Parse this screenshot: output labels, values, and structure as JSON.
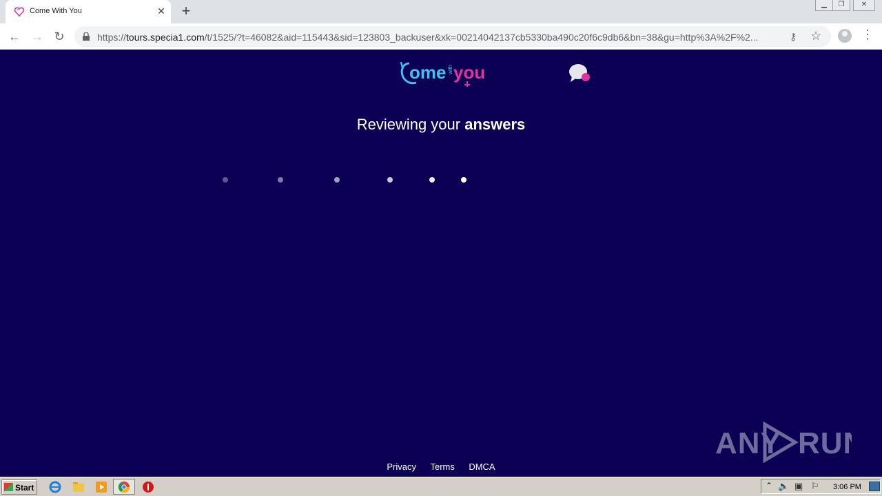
{
  "browser": {
    "tab_title": "Come With You",
    "url_host": "tours.specia1.com",
    "url_scheme": "https://",
    "url_path": "/t/1525/?t=46082&aid=115443&sid=123803_backuser&xk=00214042137cb5330ba490c20f6c9db6&bn=38&gu=http%3A%2F%2..."
  },
  "page": {
    "logo_text_left": "ome",
    "logo_text_small": "with",
    "logo_text_right": "you",
    "heading_normal": "Reviewing your ",
    "heading_bold": "answers",
    "loading_dots": 6
  },
  "footer": {
    "privacy": "Privacy",
    "terms": "Terms",
    "dmca": "DMCA"
  },
  "watermark": "ANY RUN",
  "taskbar": {
    "start_label": "Start",
    "clock": "3:06 PM"
  },
  "colors": {
    "page_bg": "#0c0054",
    "logo_cyan": "#3ec3f0",
    "logo_pink": "#e0359f"
  }
}
